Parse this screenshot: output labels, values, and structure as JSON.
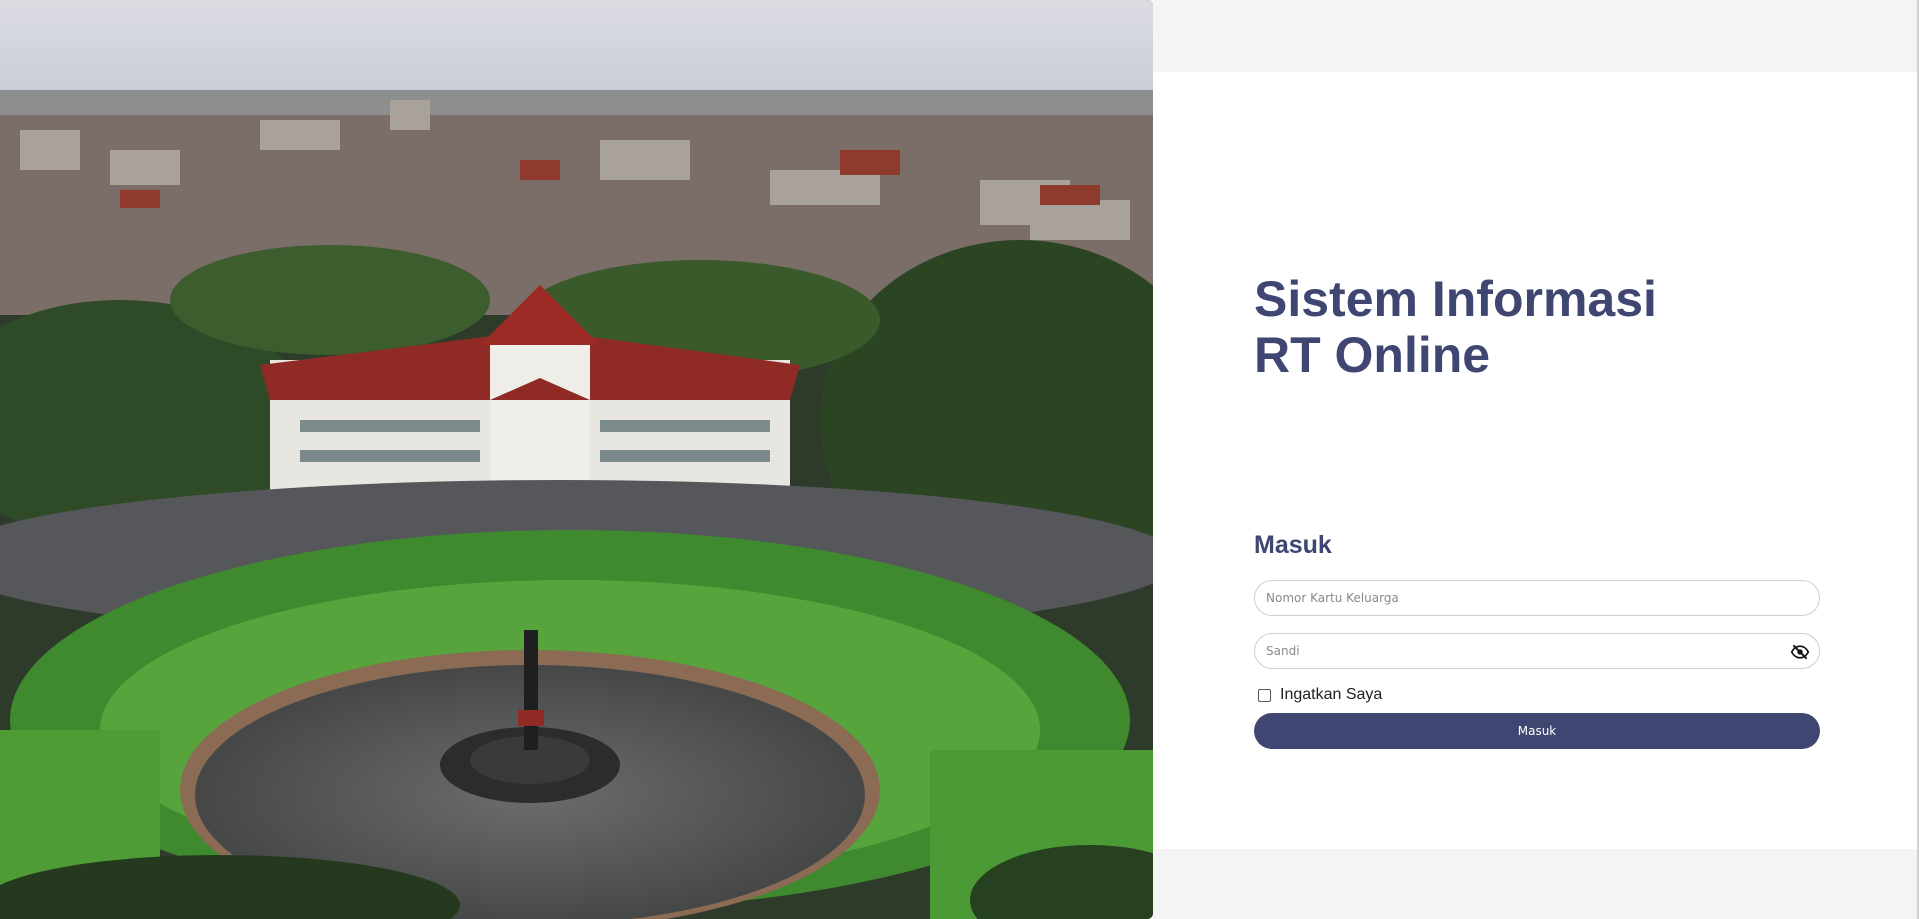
{
  "app": {
    "title_line1": "Sistem Informasi",
    "title_line2": "RT Online"
  },
  "hero_image": {
    "subject": "aerial-city-hall-photo"
  },
  "login_form": {
    "heading": "Masuk",
    "kk_placeholder": "Nomor Kartu Keluarga",
    "kk_value": "",
    "password_placeholder": "Sandi",
    "password_value": "",
    "remember_label": "Ingatkan Saya",
    "remember_checked": false,
    "submit_label": "Masuk"
  },
  "icons": {
    "password_toggle": "eye-slash-icon"
  },
  "colors": {
    "primary": "#3f4671",
    "background": "#f4f4f4",
    "panel": "#ffffff"
  }
}
